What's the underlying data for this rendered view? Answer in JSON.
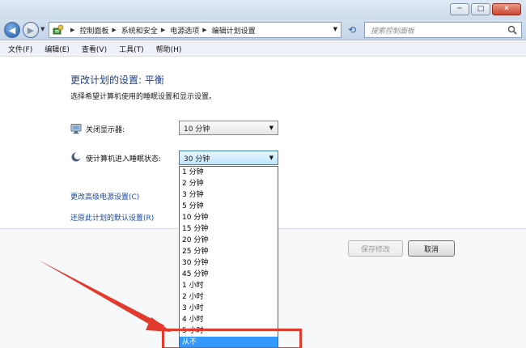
{
  "window": {
    "caption_minimize": "─",
    "caption_maximize": "□",
    "caption_close": "✕"
  },
  "address": {
    "breadcrumbs": [
      "控制面板",
      "系统和安全",
      "电源选项",
      "编辑计划设置"
    ],
    "search_placeholder": "搜索控制面板"
  },
  "menu": {
    "items": [
      "文件(F)",
      "编辑(E)",
      "查看(V)",
      "工具(T)",
      "帮助(H)"
    ]
  },
  "page": {
    "heading": "更改计划的设置: 平衡",
    "subtext": "选择希望计算机使用的睡眠设置和显示设置。"
  },
  "settings": {
    "display_off": {
      "label": "关闭显示器:",
      "value": "10 分钟"
    },
    "sleep": {
      "label": "使计算机进入睡眠状态:",
      "value": "30 分钟"
    }
  },
  "dropdown": {
    "options": [
      "1 分钟",
      "2 分钟",
      "3 分钟",
      "5 分钟",
      "10 分钟",
      "15 分钟",
      "20 分钟",
      "25 分钟",
      "30 分钟",
      "45 分钟",
      "1 小时",
      "2 小时",
      "3 小时",
      "4 小时",
      "5 小时",
      "从不"
    ],
    "highlighted": "从不"
  },
  "links": {
    "advanced": "更改高级电源设置(C)",
    "restore": "还原此计划的默认设置(R)"
  },
  "buttons": {
    "save": "保存修改",
    "cancel": "取消"
  },
  "icons": {
    "back": "back-arrow-icon",
    "forward": "forward-arrow-icon",
    "refresh": "refresh-icon",
    "search": "search-icon",
    "control_panel": "control-panel-icon",
    "monitor": "monitor-icon",
    "sleep": "moon-icon"
  },
  "colors": {
    "heading": "#1e3e8a",
    "link": "#1a4aa0",
    "selection": "#3399ff",
    "annotation": "#e23a2c"
  }
}
